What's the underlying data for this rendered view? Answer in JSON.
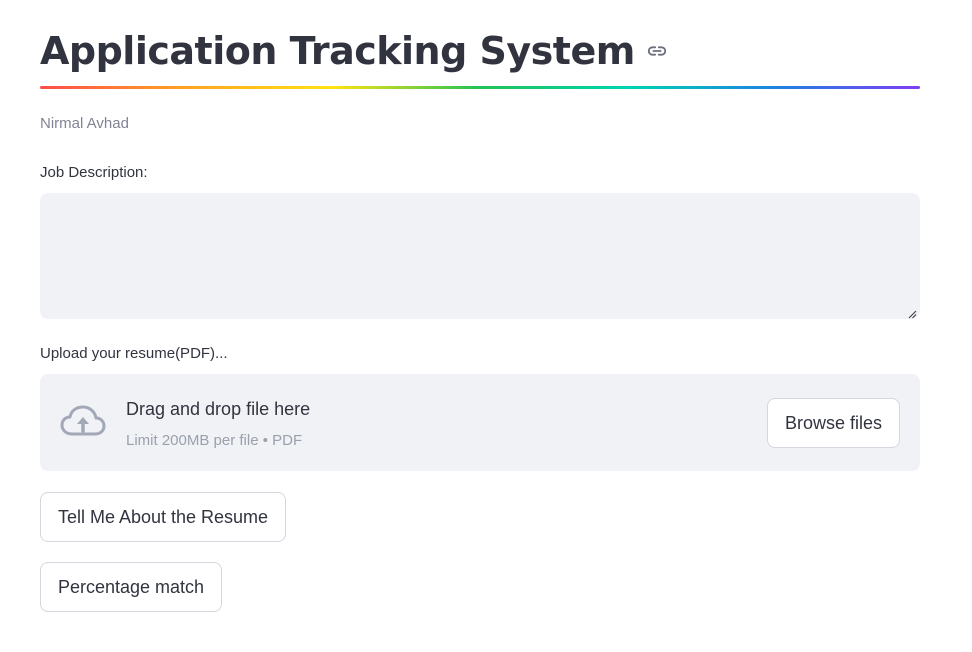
{
  "header": {
    "title": "Application Tracking System",
    "anchor_icon": "link-icon",
    "divider_colors": [
      "#ff4b4b",
      "#ffa421",
      "#ffe312",
      "#21c354",
      "#00d4b1",
      "#1c83e1",
      "#803df5"
    ]
  },
  "caption": "Nirmal Avhad",
  "job_description": {
    "label": "Job Description:",
    "value": "",
    "resize_icon": "resize-handle-icon"
  },
  "resume_upload": {
    "label": "Upload your resume(PDF)...",
    "icon": "cloud-upload-icon",
    "drop_text": "Drag and drop file here",
    "limit_text": "Limit 200MB per file • PDF",
    "browse_label": "Browse files"
  },
  "actions": {
    "tell_me_label": "Tell Me About the Resume",
    "percentage_label": "Percentage match"
  },
  "colors": {
    "text": "#31333f",
    "muted": "#808495",
    "input_bg": "#f0f2f6",
    "icon": "#a3a8b8",
    "border": "#d5d7de"
  }
}
